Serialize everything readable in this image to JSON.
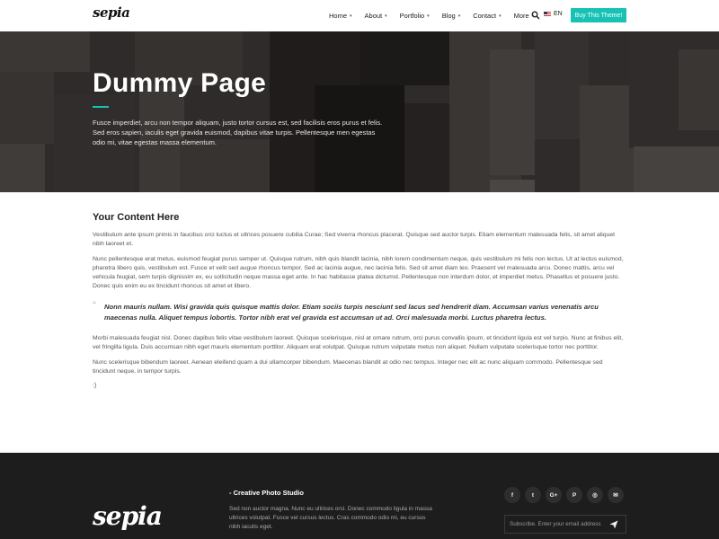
{
  "header": {
    "logo": "sepia",
    "nav": [
      {
        "label": "Home",
        "caret": "▾"
      },
      {
        "label": "About",
        "caret": "▾"
      },
      {
        "label": "Portfolio",
        "caret": "▾"
      },
      {
        "label": "Blog",
        "caret": "▾"
      },
      {
        "label": "Contact",
        "caret": "▾"
      },
      {
        "label": "More",
        "caret": "▾"
      }
    ],
    "search_icon": "search-icon",
    "language": "EN",
    "buy_button": "Buy This Theme!"
  },
  "hero": {
    "title": "Dummy Page",
    "text": "Fusce imperdiet, arcu non tempor aliquam, justo tortor cursus est, sed facilisis eros purus et felis. Sed eros sapien, iaculis eget gravida euismod, dapibus vitae turpis. Pellentesque men egestas odio mi, vitae egestas massa elementum."
  },
  "content": {
    "heading": "Your Content Here",
    "paragraph1": "Vestibulum ante ipsum primis in faucibus orci luctus et ultrices posuere cubilia Curae; Sed viverra rhoncus placerat. Quisque sed auctor turpis. Etiam elementum malesuada felis, sit amet aliquet nibh laoreet et.",
    "paragraph2": "Nunc pellentesque erat metus, euismod feugiat purus semper ut. Quisque rutrum, nibh quis blandit lacinia, nibh lorem condimentum neque, quis vestibulum mi felis non lectus. Ut at lectus euismod, pharetra libero quis, vestibulum est. Fusce et velit sed augue rhoncus tempor. Sed ac lacinia augue, nec lacinia felis. Sed sit amet diam leo. Praesent vel malesuada arcu. Donec mattis, arcu vel vehicula feugiat, sem turpis dignissim ex, eu sollicitudin neque massa eget ante. In hac habitasse platea dictumst. Pellentesque non interdum dolor, et imperdiet metus. Phasellus et posuere justo. Donec quis enim eu ex tincidunt rhoncus sit amet et libero.",
    "quote_mark": "“",
    "quote": "Nonn mauris nullam. Wisi gravida quis quisque mattis dolor. Etiam sociis turpis nesciunt sed lacus sed hendrerit diam. Accumsan varius venenatis arcu maecenas nulla. Aliquet tempus lobortis. Tortor nibh erat vel gravida est accumsan ut ad. Orci malesuada morbi. Luctus pharetra lectus.",
    "paragraph3": "Morbi malesuada feugiat nisl. Donec dapibus felis vitae vestibulum laoreet. Quisque scelerisque, nisl at ornare rutrum, orci purus convallis ipsum, et tincidunt ligula est vel turpis. Nunc at finibus elit, vel fringilla ligula. Duis accumsan nibh eget mauris elementum porttitor. Aliquam erat volutpat. Quisque rutrum vulputate metus non aliquet. Nullam vulputate scelerisque tortor nec porttitor.",
    "paragraph4": "Nunc scelerisque bibendum laoreet. Aenean eleifend quam a dui ullamcorper bibendum. Maecenas blandit at odio nec tempus. Integer nec elit ac nunc aliquam commodo. Pellentesque sed tincidunt neque, in tempor turpis.",
    "smile": ":)"
  },
  "footer": {
    "logo": "sepia",
    "tagline": "- Creative Photo Studio",
    "text": "Sed non auctor magna. Nunc eu ultrices orci. Donec commodo ligula in massa ultrices volutpat. Fusce vel cursus lectus. Cras commodo odio mi, eu cursus nibh iaculis eget.",
    "socials": [
      {
        "icon": "facebook-icon",
        "glyph": "f"
      },
      {
        "icon": "twitter-icon",
        "glyph": "t"
      },
      {
        "icon": "google-plus-icon",
        "glyph": "G+"
      },
      {
        "icon": "pinterest-icon",
        "glyph": "P"
      },
      {
        "icon": "dribbble-icon",
        "glyph": "◎"
      },
      {
        "icon": "email-icon",
        "glyph": "✉"
      }
    ],
    "subscribe_placeholder": "Subscribe. Enter your email address"
  },
  "colors": {
    "accent": "#17c2b4",
    "hero_dark": "#2b2827",
    "footer_bg": "#1d1d1d"
  }
}
